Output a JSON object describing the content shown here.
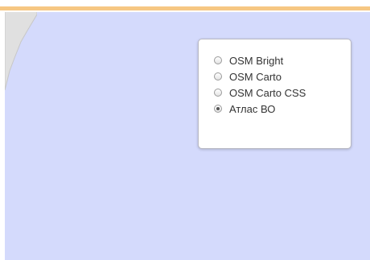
{
  "map": {
    "water_color": "#d4dafc",
    "land_color": "#e0e0e0",
    "border_color": "#f6c783"
  },
  "layer_switcher": {
    "options": [
      {
        "label": "OSM Bright",
        "checked": false
      },
      {
        "label": "OSM Carto",
        "checked": false
      },
      {
        "label": "OSM Carto CSS",
        "checked": false
      },
      {
        "label": "Атлас ВО",
        "checked": true
      }
    ]
  }
}
